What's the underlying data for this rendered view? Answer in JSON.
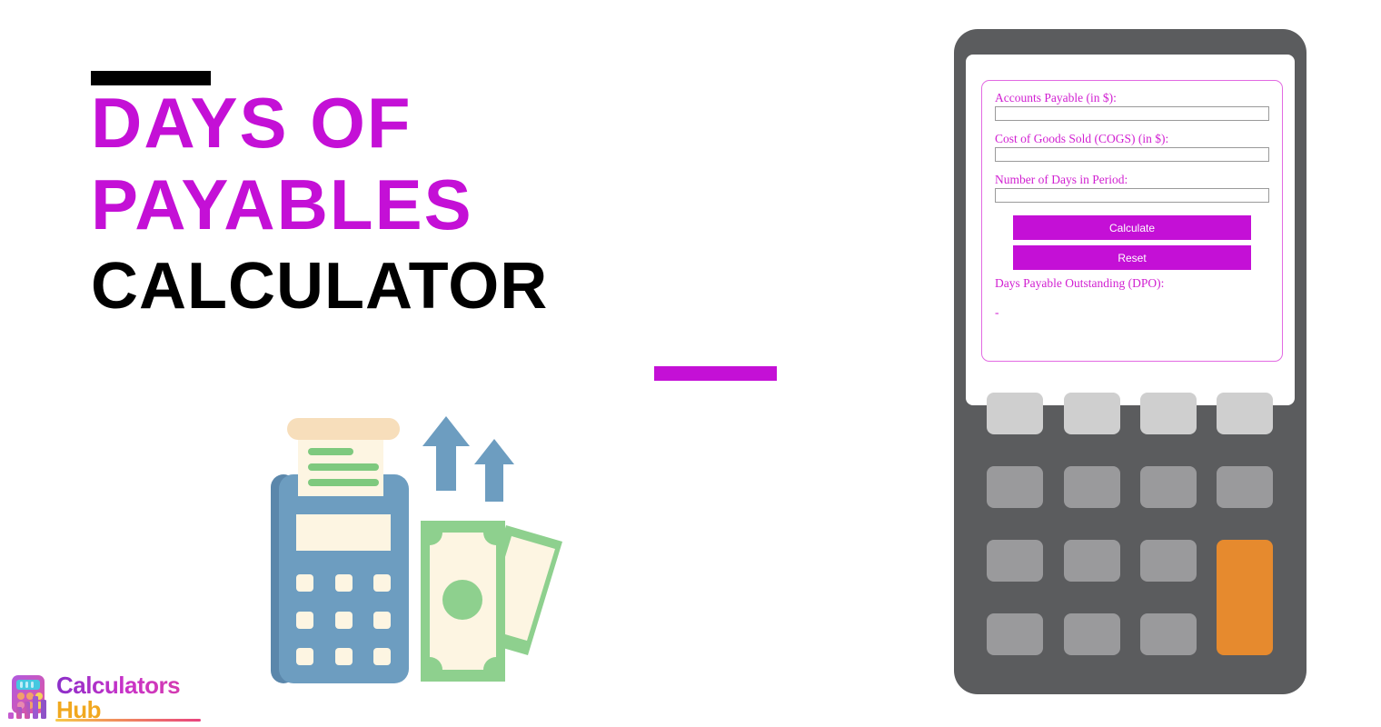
{
  "page": {
    "background_color": "#ffffff",
    "accent_color": "#c410d6",
    "body_color": "#5b5c5e"
  },
  "headline": {
    "line1": "Days of",
    "line2": "Payables",
    "line3": "Calculator",
    "line1_color": "#c410d6",
    "line2_color": "#c410d6",
    "line3_color": "#000000",
    "top_bar_color": "#000000",
    "bottom_bar_color": "#c410d6"
  },
  "illustration": {
    "name": "pos-terminal-with-cash-and-up-arrows",
    "terminal_color": "#6d9dc0",
    "terminal_shadow_color": "#5b87ab",
    "receipt_color": "#fdf5e2",
    "receipt_top_color": "#f7debb",
    "receipt_line_color": "#7ec97e",
    "key_color": "#fdf5e2",
    "arrow_color": "#6d9dc0",
    "bill_color": "#8ed08e",
    "bill_inner_color": "#fdf5e2"
  },
  "logo": {
    "word1": "Calculators",
    "word2": "Hub",
    "word1_color": "#c832c8",
    "word2_color": "#f0a81e",
    "mark_name": "calculator-bar-chart-logo-icon"
  },
  "calculator": {
    "fields": [
      {
        "label": "Accounts Payable (in $):",
        "value": "",
        "placeholder": ""
      },
      {
        "label": "Cost of Goods Sold (COGS) (in $):",
        "value": "",
        "placeholder": ""
      },
      {
        "label": "Number of Days in Period:",
        "value": "",
        "placeholder": ""
      }
    ],
    "buttons": {
      "calculate": "Calculate",
      "reset": "Reset",
      "color": "#c410d6",
      "text_color": "#ffffff"
    },
    "result": {
      "label": "Days Payable Outstanding (DPO):",
      "value": "-"
    },
    "label_color": "#d11fd1",
    "form_border_color": "#e26ae2"
  },
  "keypad": {
    "rows": [
      {
        "style": "light",
        "keys": [
          "",
          "",
          "",
          ""
        ]
      },
      {
        "style": "medium",
        "keys": [
          "",
          "",
          "",
          ""
        ]
      },
      {
        "style": "medium",
        "keys": [
          "",
          "",
          ""
        ]
      },
      {
        "style": "medium",
        "keys": [
          "",
          "",
          ""
        ]
      }
    ],
    "accent_key": {
      "style": "orange",
      "label": ""
    },
    "light_color": "#cfcfcf",
    "medium_color": "#9a9a9c",
    "orange_color": "#e68a2e"
  }
}
